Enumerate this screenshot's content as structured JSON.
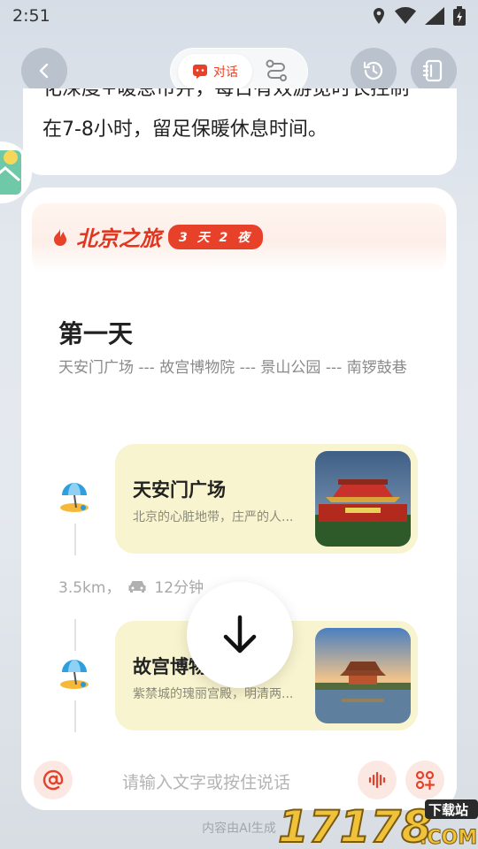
{
  "status_bar": {
    "time": "2:51"
  },
  "nav": {
    "back_icon": "chevron-left-icon",
    "chat_tab_label": "对话",
    "route_tab_icon": "route-icon",
    "history_icon": "history-icon",
    "notes_icon": "notebook-icon"
  },
  "previous_message": {
    "line1": "化深度+暖息市并，每日有效游览时长控制",
    "line2": "在7-8小时，留足保暖休息时间。"
  },
  "trip": {
    "title": "北京之旅",
    "badge": "3 天 2 夜",
    "day_title": "第一天",
    "day_route": "天安门广场 --- 故宫博物院 --- 景山公园 --- 南锣鼓巷",
    "stops": [
      {
        "name": "天安门广场",
        "desc": "北京的心脏地带，庄严的人..."
      },
      {
        "name": "故宫博物院",
        "desc": "紫禁城的瑰丽宫殿，明清两..."
      }
    ],
    "transit": {
      "distance": "3.5km，",
      "time": "12分钟"
    }
  },
  "input": {
    "placeholder": "请输入文字或按住说话"
  },
  "footer": {
    "ai_note": "内容由AI生成"
  },
  "watermark": {
    "text": "17178",
    "tag": "下载站",
    "domain": ".COM"
  },
  "colors": {
    "accent": "#e8412a",
    "poi_card": "#f8f4cf"
  }
}
